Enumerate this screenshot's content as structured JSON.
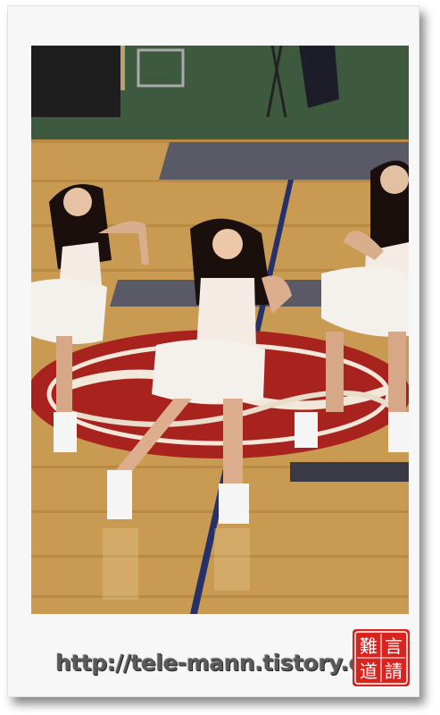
{
  "photo": {
    "subject": "cheerleaders-dancing-on-basketball-court",
    "colors": {
      "floor": "#c99a52",
      "floor_dark": "#b07a35",
      "court_red": "#a8221e",
      "banner": "#5a5a66",
      "skirt": "#f4f0ec"
    }
  },
  "watermark": {
    "url": "http://tele-mann.tistory.com",
    "seal_glyphs": [
      "難",
      "言",
      "道",
      "請"
    ],
    "seal_color": "#d8231f"
  }
}
